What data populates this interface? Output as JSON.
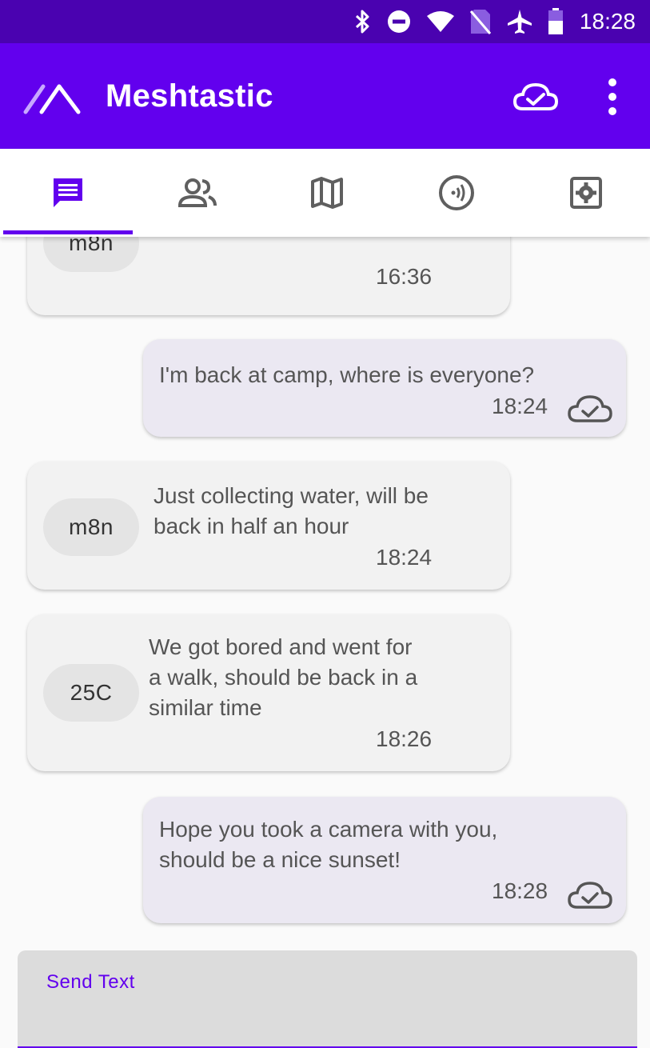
{
  "status_bar": {
    "time": "18:28",
    "icons": [
      "bluetooth-icon",
      "dnd-icon",
      "wifi-icon",
      "no-sim-icon",
      "airplane-icon",
      "battery-icon"
    ]
  },
  "app_bar": {
    "title": "Meshtastic",
    "color": "#6200ee",
    "status_color": "#4a02b0",
    "icons": [
      "meshtastic-logo-icon",
      "cloud-connected-icon",
      "more-vert-icon"
    ]
  },
  "tabs": [
    {
      "icon": "messages-icon",
      "selected": true
    },
    {
      "icon": "users-icon",
      "selected": false
    },
    {
      "icon": "map-icon",
      "selected": false
    },
    {
      "icon": "channel-icon",
      "selected": false
    },
    {
      "icon": "settings-icon",
      "selected": false
    }
  ],
  "messages": [
    {
      "direction": "in",
      "sender": "m8n",
      "text": "",
      "time": "16:36"
    },
    {
      "direction": "out",
      "text": "I'm back at camp, where is everyone?",
      "time": "18:24",
      "status_icon": "cloud-done-icon"
    },
    {
      "direction": "in",
      "sender": "m8n",
      "text": "Just collecting water, will be\nback in half an hour",
      "time": "18:24"
    },
    {
      "direction": "in",
      "sender": "25C",
      "text": "We got bored and went for\na walk, should be back in a\nsimilar time",
      "time": "18:26"
    },
    {
      "direction": "out",
      "text": "Hope you took a camera with you,\nshould be a nice sunset!",
      "time": "18:28",
      "status_icon": "cloud-done-icon"
    }
  ],
  "input": {
    "label": "Send Text",
    "value": ""
  }
}
